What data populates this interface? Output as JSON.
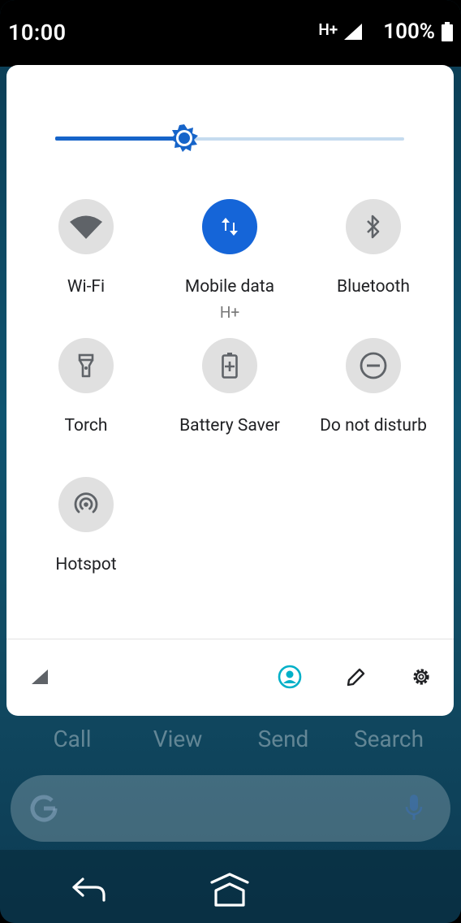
{
  "status_bar": {
    "time": "10:00",
    "network_type": "H+",
    "battery_percent": "100%",
    "icons": [
      "signal-icon",
      "battery-icon"
    ]
  },
  "quick_settings": {
    "brightness_level": 0.37,
    "tiles": [
      {
        "label": "Wi-Fi",
        "icon": "wifi-icon",
        "active": false
      },
      {
        "label": "Mobile data",
        "sublabel": "H+",
        "icon": "mobile-data-icon",
        "active": true
      },
      {
        "label": "Bluetooth",
        "icon": "bluetooth-icon",
        "active": false
      },
      {
        "label": "Torch",
        "icon": "torch-icon",
        "active": false
      },
      {
        "label": "Battery Saver",
        "icon": "battery-saver-icon",
        "active": false
      },
      {
        "label": "Do not disturb",
        "icon": "dnd-icon",
        "active": false
      },
      {
        "label": "Hotspot",
        "icon": "hotspot-icon",
        "active": false
      }
    ],
    "footer_icons": [
      "signal-small-icon",
      "user-icon",
      "edit-icon",
      "settings-icon"
    ],
    "accent_color": "#1565d8",
    "user_icon_color": "#00b0c8"
  },
  "home": {
    "shortcuts": [
      "Call",
      "View",
      "Send",
      "Search"
    ],
    "search_icons": [
      "google-icon",
      "mic-icon"
    ]
  },
  "nav_bar": {
    "icons": [
      "back-icon",
      "home-icon"
    ]
  }
}
